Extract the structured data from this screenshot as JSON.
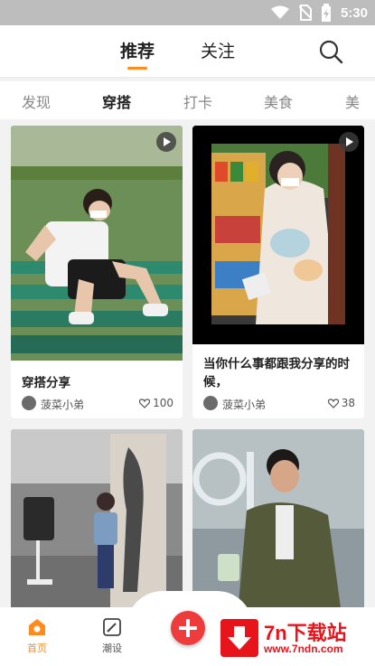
{
  "status_bar": {
    "time": "5:30"
  },
  "top_tabs": [
    {
      "label": "推荐",
      "active": true
    },
    {
      "label": "关注",
      "active": false
    }
  ],
  "categories": [
    {
      "label": "发现"
    },
    {
      "label": "穿搭",
      "active": true
    },
    {
      "label": "打卡"
    },
    {
      "label": "美食"
    },
    {
      "label": "美"
    }
  ],
  "cards": [
    {
      "title": "穿搭分享",
      "author": "菠菜小弟",
      "likes": "100",
      "is_video": true
    },
    {
      "title": "当你什么事都跟我分享的时候，",
      "author": "菠菜小弟",
      "likes": "38",
      "is_video": true
    },
    {
      "title": "",
      "is_video": false
    },
    {
      "title": "",
      "is_video": false
    }
  ],
  "bottom_nav": [
    {
      "label": "首页",
      "icon": "home-icon",
      "active": true
    },
    {
      "label": "潮设",
      "icon": "edit-icon",
      "active": false
    }
  ],
  "watermark": {
    "title": "7n下载站",
    "url": "www.7ndn.com"
  },
  "colors": {
    "accent": "#ff8a1e",
    "fab": "#ee3b3b",
    "watermark": "#e8141c"
  }
}
